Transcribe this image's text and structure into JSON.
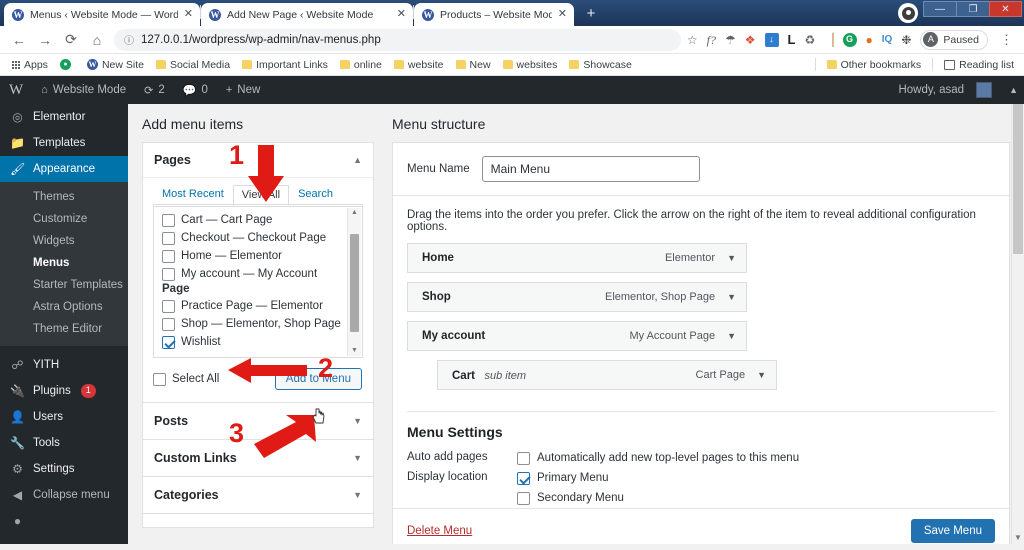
{
  "browser": {
    "tabs": [
      {
        "title": "Menus ‹ Website Mode — Word",
        "favicon": "wordpress-icon",
        "close": "✕"
      },
      {
        "title": "Add New Page ‹ Website Mode",
        "favicon": "wordpress-icon",
        "close": "✕"
      },
      {
        "title": "Products – Website Mode",
        "favicon": "wordpress-icon",
        "close": "✕"
      }
    ],
    "new_tab_label": "+",
    "window_controls": {
      "minimize": "—",
      "maximize": "❐",
      "close": "✕"
    },
    "nav": {
      "back": "←",
      "forward": "→",
      "reload": "⟳",
      "home": "⌂"
    },
    "url": "127.0.0.1/wordpress/wp-admin/nav-menus.php",
    "url_info_icon": "info-circle-icon",
    "omnibox_icons": [
      "star-icon",
      "f-question-icon",
      "camera-icon",
      "palette-icon",
      "download-icon",
      "lastpass-icon",
      "recycle-icon",
      "ruler-icon",
      "grammarly-icon",
      "fire-icon",
      "iq-icon",
      "puzzle-icon"
    ],
    "profile": {
      "initial": "A",
      "status": "Paused"
    },
    "menu_icon": "kebab-menu-icon",
    "bookmarks": [
      {
        "label": "Apps",
        "icon": "apps-grid-icon"
      },
      {
        "label": "",
        "icon": "green-circle-icon"
      },
      {
        "label": "New Site",
        "icon": "wordpress-icon"
      },
      {
        "label": "Social Media",
        "icon": "folder-icon"
      },
      {
        "label": "Important Links",
        "icon": "folder-icon"
      },
      {
        "label": "online",
        "icon": "folder-icon"
      },
      {
        "label": "website",
        "icon": "folder-icon"
      },
      {
        "label": "New",
        "icon": "folder-icon"
      },
      {
        "label": "websites",
        "icon": "folder-icon"
      },
      {
        "label": "Showcase",
        "icon": "folder-icon"
      }
    ],
    "bookmarks_right": [
      {
        "label": "Other bookmarks",
        "icon": "folder-icon"
      },
      {
        "label": "Reading list",
        "icon": "reading-list-icon"
      }
    ]
  },
  "adminbar": {
    "logo": "W",
    "site_name": "Website Mode",
    "home_icon": "home-icon",
    "updates": {
      "icon": "updates-icon",
      "count": "2"
    },
    "comments": {
      "icon": "comment-icon",
      "count": "0"
    },
    "new": {
      "icon": "plus-icon",
      "label": "New"
    },
    "howdy": "Howdy, asad",
    "collapse_arrow": "▲"
  },
  "sidebar": {
    "items": [
      {
        "label": "Elementor",
        "icon": "elementor-icon",
        "current": false
      },
      {
        "label": "Templates",
        "icon": "templates-icon",
        "current": false
      },
      {
        "label": "Appearance",
        "icon": "appearance-brush-icon",
        "current": true
      }
    ],
    "submenu": [
      {
        "label": "Themes",
        "active": false
      },
      {
        "label": "Customize",
        "active": false
      },
      {
        "label": "Widgets",
        "active": false
      },
      {
        "label": "Menus",
        "active": true
      },
      {
        "label": "Starter Templates",
        "active": false
      },
      {
        "label": "Astra Options",
        "active": false
      },
      {
        "label": "Theme Editor",
        "active": false
      }
    ],
    "items_after": [
      {
        "label": "YITH",
        "icon": "yith-icon",
        "badge": ""
      },
      {
        "label": "Plugins",
        "icon": "plugins-plug-icon",
        "badge": "1"
      },
      {
        "label": "Users",
        "icon": "users-icon",
        "badge": ""
      },
      {
        "label": "Tools",
        "icon": "tools-wrench-icon",
        "badge": ""
      },
      {
        "label": "Settings",
        "icon": "settings-sliders-icon",
        "badge": ""
      },
      {
        "label": "Collapse menu",
        "icon": "collapse-arrow-icon",
        "badge": ""
      }
    ]
  },
  "add_menu_items": {
    "heading": "Add menu items",
    "pages_panel": {
      "title": "Pages",
      "caret": "▲",
      "tabs": [
        {
          "label": "Most Recent",
          "active": false
        },
        {
          "label": "View All",
          "active": true
        },
        {
          "label": "Search",
          "active": false
        }
      ],
      "items": [
        {
          "label": "Cart — Cart Page",
          "checked": false,
          "continuation": ""
        },
        {
          "label": "Checkout — Checkout Page",
          "checked": false,
          "continuation": ""
        },
        {
          "label": "Home — Elementor",
          "checked": false,
          "continuation": ""
        },
        {
          "label": "My account — My Account",
          "checked": false,
          "continuation": "Page"
        },
        {
          "label": "Practice Page — Elementor",
          "checked": false,
          "continuation": ""
        },
        {
          "label": "Shop — Elementor, Shop Page",
          "checked": false,
          "continuation": ""
        },
        {
          "label": "Wishlist",
          "checked": true,
          "continuation": ""
        }
      ],
      "select_all_label": "Select All",
      "add_button_label": "Add to Menu"
    },
    "closed_panels": [
      {
        "title": "Posts",
        "caret": "▼"
      },
      {
        "title": "Custom Links",
        "caret": "▼"
      },
      {
        "title": "Categories",
        "caret": "▼"
      }
    ]
  },
  "menu_structure": {
    "heading": "Menu structure",
    "name_label": "Menu Name",
    "name_value": "Main Menu",
    "hint": "Drag the items into the order you prefer. Click the arrow on the right of the item to reveal additional configuration options.",
    "items": [
      {
        "title": "Home",
        "subitem_tag": "",
        "type": "Elementor",
        "caret": "▼",
        "is_sub": false
      },
      {
        "title": "Shop",
        "subitem_tag": "",
        "type": "Elementor, Shop Page",
        "caret": "▼",
        "is_sub": false
      },
      {
        "title": "My account",
        "subitem_tag": "",
        "type": "My Account Page",
        "caret": "▼",
        "is_sub": false
      },
      {
        "title": "Cart",
        "subitem_tag": "sub item",
        "type": "Cart Page",
        "caret": "▼",
        "is_sub": true
      }
    ],
    "settings": {
      "title": "Menu Settings",
      "auto_add_label": "Auto add pages",
      "auto_add_option": "Automatically add new top-level pages to this menu",
      "auto_add_checked": false,
      "display_label": "Display location",
      "locations": [
        {
          "label": "Primary Menu",
          "checked": true
        },
        {
          "label": "Secondary Menu",
          "checked": false
        }
      ]
    },
    "delete_label": "Delete Menu",
    "save_label": "Save Menu"
  },
  "annotations": [
    {
      "number": "1",
      "points_to": "view-all-tab"
    },
    {
      "number": "2",
      "points_to": "wishlist-checkbox"
    },
    {
      "number": "3",
      "points_to": "add-to-menu-button"
    }
  ],
  "colors": {
    "wp_blue": "#0073aa",
    "wp_dark": "#23282d",
    "wp_darker": "#32373c",
    "button_primary": "#2271b1",
    "annotation_red": "#e01b15",
    "badge_red": "#d63638",
    "delete_red": "#b32d2e"
  }
}
